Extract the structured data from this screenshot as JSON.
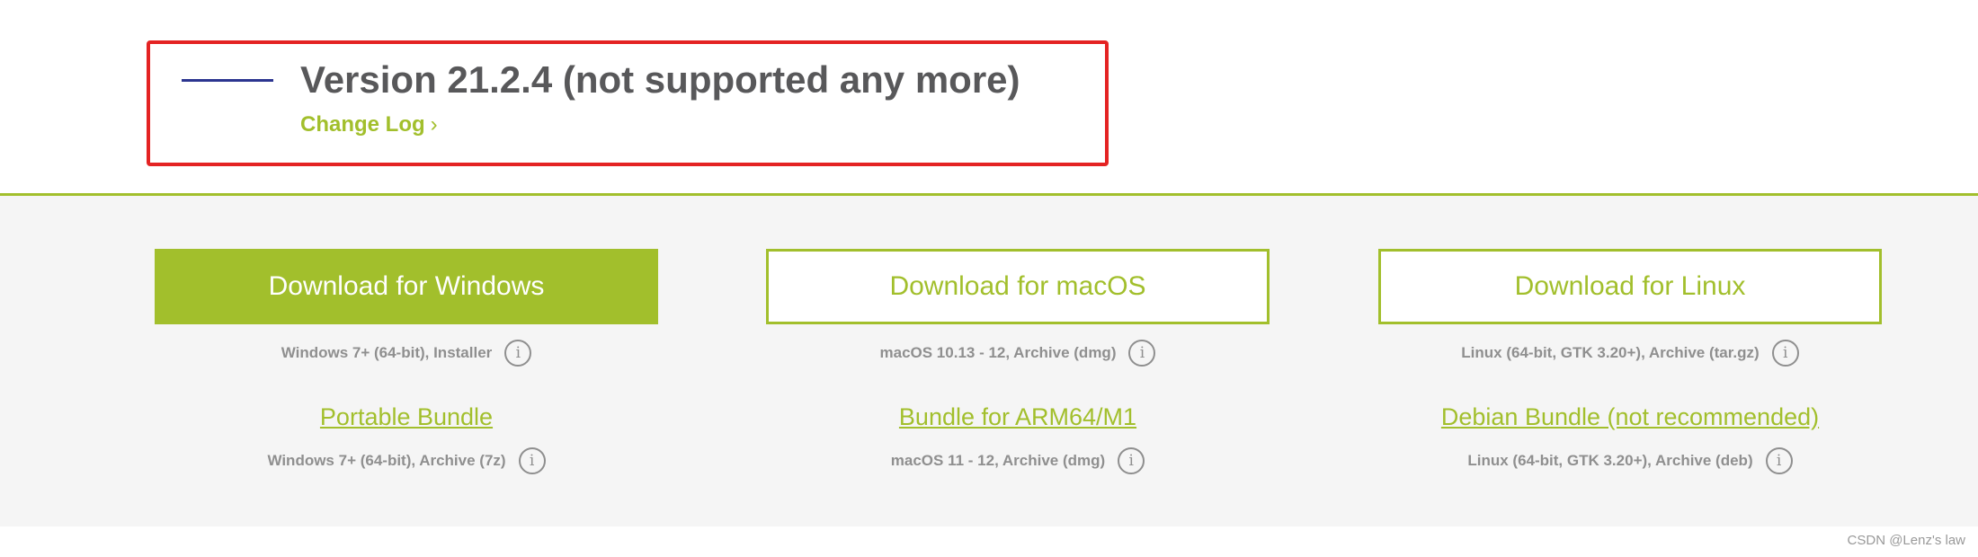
{
  "version_section": {
    "title": "Version 21.2.4 (not supported any more)",
    "changelog_label": "Change Log",
    "changelog_chevron": "›"
  },
  "downloads": [
    {
      "platform": "windows",
      "button_label": "Download for Windows",
      "button_style": "primary",
      "installer_info": "Windows 7+ (64-bit), Installer",
      "bundle_label": "Portable Bundle",
      "bundle_info": "Windows 7+ (64-bit), Archive (7z)"
    },
    {
      "platform": "macos",
      "button_label": "Download for macOS",
      "button_style": "outline",
      "installer_info": "macOS 10.13 - 12, Archive (dmg)",
      "bundle_label": "Bundle for ARM64/M1",
      "bundle_info": "macOS 11 - 12, Archive (dmg)"
    },
    {
      "platform": "linux",
      "button_label": "Download for Linux",
      "button_style": "outline",
      "installer_info": "Linux (64-bit, GTK 3.20+), Archive (tar.gz)",
      "bundle_label": "Debian Bundle (not recommended)",
      "bundle_info": "Linux (64-bit, GTK 3.20+), Archive (deb)"
    }
  ],
  "info_icon": {
    "glyph": "i",
    "name": "info-icon"
  },
  "watermark": "CSDN @Lenz's law",
  "colors": {
    "accent_green": "#a2bf2c",
    "highlight_red": "#e42323",
    "accent_line_blue": "#2c3590",
    "title_gray": "#58585a",
    "meta_gray": "#8f8f8f",
    "band_bg": "#f5f5f5"
  }
}
